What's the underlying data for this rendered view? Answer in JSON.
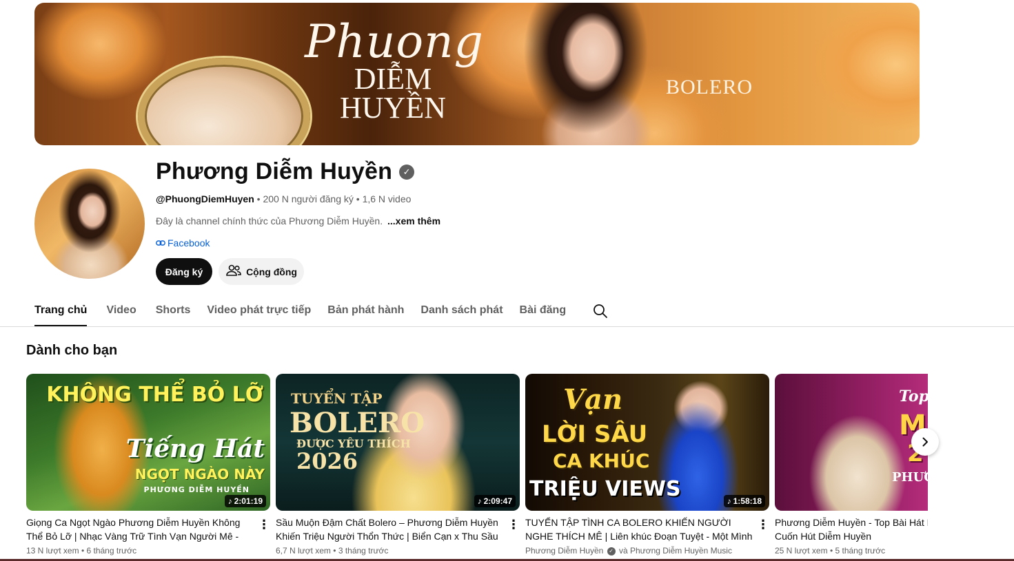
{
  "banner": {
    "script_text": "Phuong",
    "name_line1": "DIỄM",
    "name_line2": "HUYỀN",
    "tag": "BOLERO"
  },
  "channel": {
    "name": "Phương Diễm Huyền",
    "handle": "@PhuongDiemHuyen",
    "subscribers": "200 N người đăng ký",
    "videos": "1,6 N video",
    "description": "Đây là channel chính thức của Phương Diễm Huyền.",
    "more": "...xem thêm",
    "link": "Facebook"
  },
  "buttons": {
    "subscribe": "Đăng ký",
    "community": "Cộng đồng"
  },
  "tabs": [
    {
      "label": "Trang chủ"
    },
    {
      "label": "Video"
    },
    {
      "label": "Shorts"
    },
    {
      "label": "Video phát trực tiếp"
    },
    {
      "label": "Bản phát hành"
    },
    {
      "label": "Danh sách phát"
    },
    {
      "label": "Bài đăng"
    }
  ],
  "section": {
    "title": "Dành cho bạn"
  },
  "videos": [
    {
      "title": "Giọng Ca Ngọt Ngào Phương Diễm Huyền Không Thể Bỏ Lỡ | Nhạc Vàng Trữ Tình Vạn Người Mê - Gi...",
      "duration": "2:01:19",
      "views": "13 N lượt xem",
      "age": "6 tháng trước",
      "thumb_text": [
        "KHÔNG THỂ BỎ LỠ",
        "Tiếng Hát",
        "NGỌT NGÀO NÀY",
        "PHƯƠNG DIỄM HUYỀN"
      ]
    },
    {
      "title": "Sầu Muộn Đậm Chất Bolero – Phương Diễm Huyền Khiến Triệu Người Thổn Thức | Biển Cạn x Thu Sầu",
      "duration": "2:09:47",
      "views": "6,7 N lượt xem",
      "age": "3 tháng trước",
      "thumb_text": [
        "TUYỂN TẬP",
        "BOLERO",
        "ĐƯỢC YÊU THÍCH",
        "2026"
      ]
    },
    {
      "title": "TUYỂN TẬP TÌNH CA BOLERO KHIẾN NGƯỜI NGHE THÍCH MÊ | Liên khúc Đoạn Tuyệt - Một Mình",
      "duration": "1:58:18",
      "channel": "Phương Diễm Huyền",
      "channel_extra": "và Phương Diễm Huyền Music",
      "thumb_text": [
        "Vạn",
        "LỜI SÂU",
        "CA KHÚC",
        "TRIỆU VIEWS"
      ]
    },
    {
      "title": "Phương Diễm Huyền - Top Bài Hát Mới Tiếng Hát Quá Cuốn Hút Diễm Huyền",
      "views": "25 N lượt xem",
      "age": "5 tháng trước",
      "thumb_text": [
        "Top",
        "MỚ",
        "2",
        "PHƯƠ"
      ]
    }
  ],
  "colors": {
    "text_primary": "#0f0f0f",
    "text_secondary": "#606060",
    "link": "#065fd4",
    "subscribe_bg": "#0f0f0f",
    "chip_bg": "#f2f2f2"
  },
  "icons": [
    "verified-icon",
    "link-icon",
    "community-icon",
    "search-icon",
    "more-vert-icon",
    "music-note-icon",
    "chevron-right-icon"
  ]
}
